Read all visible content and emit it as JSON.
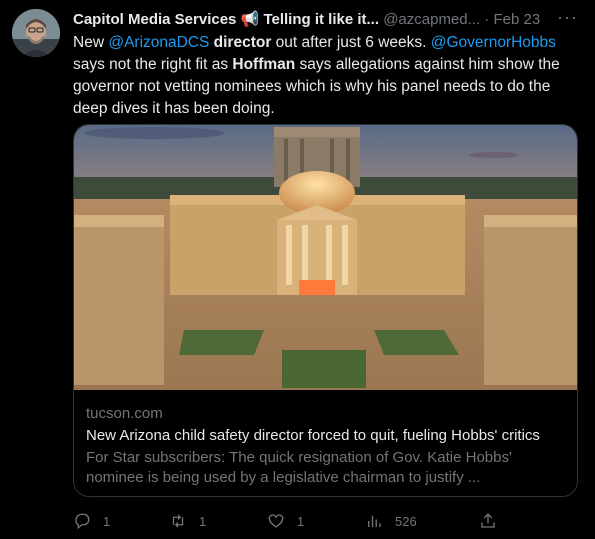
{
  "header": {
    "display_name": "Capitol Media Services",
    "name_emoji": "📢",
    "name_suffix": "Telling it like it...",
    "handle": "@azcapmed...",
    "separator": "·",
    "date": "Feb 23",
    "more_icon": "more-horizontal-icon"
  },
  "tweet": {
    "t1": "New ",
    "m1": "@ArizonaDCS",
    "b1": " director",
    "t2": " out after just 6 weeks. ",
    "m2": "@GovernorHobbs",
    "t3": " says not the right fit as ",
    "b2": "Hoffman",
    "t4": " says allegations against him show the governor not vetting nominees which is why his panel needs to do the deep dives it has been doing."
  },
  "card": {
    "image_alt": "Arizona State Capitol building at dusk",
    "domain": "tucson.com",
    "title": "New Arizona child safety director forced to quit, fueling Hobbs' critics",
    "description": "For Star subscribers: The quick resignation of Gov. Katie Hobbs' nominee is being used by a legislative chairman to justify ..."
  },
  "actions": {
    "reply_count": "1",
    "retweet_count": "1",
    "like_count": "1",
    "views_count": "526",
    "icons": [
      "reply-icon",
      "retweet-icon",
      "like-icon",
      "views-icon",
      "share-icon"
    ]
  },
  "colors": {
    "background": "#000000",
    "text": "#e7e9ea",
    "muted": "#71767b",
    "link": "#1d9bf0",
    "border": "#2f3336"
  }
}
